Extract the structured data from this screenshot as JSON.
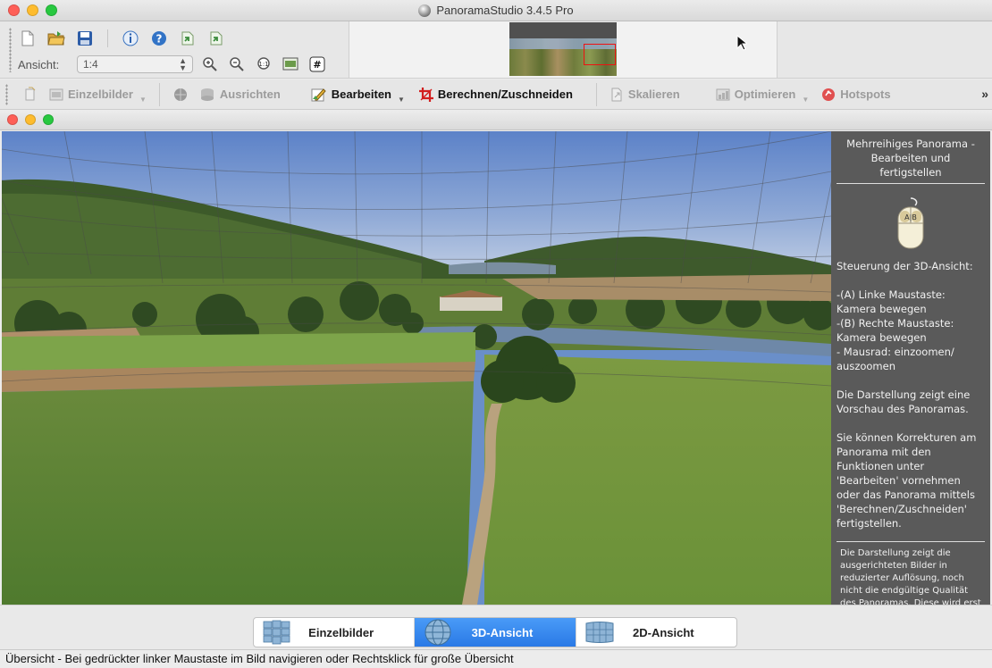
{
  "window": {
    "title": "PanoramaStudio 3.4.5 Pro"
  },
  "toolbar": {
    "zoom_label": "Ansicht:",
    "zoom_value": "1:4",
    "icons": [
      "new-document-icon",
      "open-folder-icon",
      "save-icon",
      "info-icon",
      "help-icon",
      "import-icon",
      "export-icon"
    ],
    "zoom_icons": [
      "zoom-in-icon",
      "zoom-out-icon",
      "zoom-100-icon",
      "fit-window-icon",
      "grid-icon"
    ]
  },
  "workflow": {
    "items": [
      {
        "label": "Einzelbilder",
        "state": "disabled"
      },
      {
        "label": "Ausrichten",
        "state": "disabled"
      },
      {
        "label": "Bearbeiten",
        "state": "active"
      },
      {
        "label": "Berechnen/Zuschneiden",
        "state": "active"
      },
      {
        "label": "Skalieren",
        "state": "disabled"
      },
      {
        "label": "Optimieren",
        "state": "disabled"
      },
      {
        "label": "Hotspots",
        "state": "disabled"
      }
    ],
    "more": "»"
  },
  "info_panel": {
    "heading": "Mehrreihiges Panorama - Bearbeiten und fertigstellen",
    "body": "Steuerung der 3D-Ansicht:\n\n-(A) Linke Maustaste:\nKamera bewegen\n-(B) Rechte Maustaste:\nKamera bewegen\n- Mausrad: einzoomen/\nauszoomen\n\nDie Darstellung zeigt eine Vorschau des Panoramas.\n\nSie können Korrekturen am Panorama mit den Funktionen unter 'Bearbeiten' vornehmen oder das Panorama mittels 'Berechnen/Zuschneiden' fertigstellen.",
    "note": "Die Darstellung zeigt die ausgerichteten Bilder in reduzierter Auflösung, noch nicht die endgültige Qualität des Panoramas. Diese wird erst mit 'Berechnen/Zuschneiden'",
    "mouse_label": "A|B"
  },
  "view_tabs": [
    {
      "label": "Einzelbilder",
      "icon": "tiles-icon",
      "selected": false
    },
    {
      "label": "3D-Ansicht",
      "icon": "globe-icon",
      "selected": true
    },
    {
      "label": "2D-Ansicht",
      "icon": "flat-panorama-icon",
      "selected": false
    }
  ],
  "status_text": "Übersicht - Bei gedrückter linker Maustaste im Bild navigieren oder Rechtsklick für große Übersicht",
  "colors": {
    "accent": "#2a79e6",
    "crop_icon": "#d21f1f",
    "hotspot_icon": "#e05050",
    "info_panel_bg": "#464646"
  }
}
